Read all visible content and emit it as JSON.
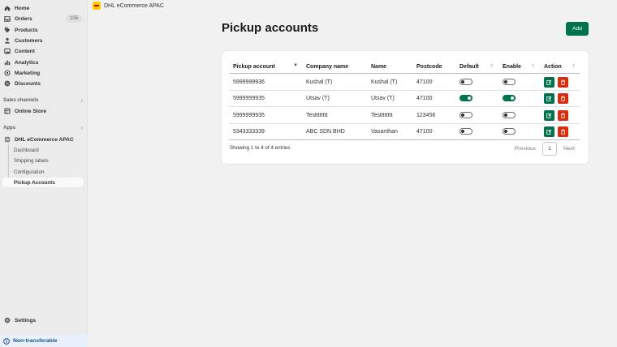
{
  "app": {
    "title": "DHL eCommerce APAC"
  },
  "sidebar": {
    "main": [
      {
        "label": "Home",
        "icon": "home-icon"
      },
      {
        "label": "Orders",
        "icon": "inbox-icon",
        "badge": "105"
      },
      {
        "label": "Products",
        "icon": "tag-icon"
      },
      {
        "label": "Customers",
        "icon": "person-icon"
      },
      {
        "label": "Content",
        "icon": "image-icon"
      },
      {
        "label": "Analytics",
        "icon": "bar-chart-icon"
      },
      {
        "label": "Marketing",
        "icon": "target-icon"
      },
      {
        "label": "Discounts",
        "icon": "discount-icon"
      }
    ],
    "sales_channels": {
      "label": "Sales channels",
      "items": [
        {
          "label": "Online Store",
          "icon": "store-icon"
        }
      ]
    },
    "apps": {
      "label": "Apps",
      "app_name": "DHL eCommerce APAC",
      "sub_items": [
        "Dashboard",
        "Shipping labels",
        "Configuration",
        "Pickup Accounts"
      ],
      "active": "Pickup Accounts"
    },
    "settings": {
      "label": "Settings",
      "icon": "gear-icon"
    },
    "footer": {
      "label": "Non-transferable",
      "icon": "info-icon"
    }
  },
  "page": {
    "title": "Pickup accounts",
    "add_label": "Add"
  },
  "table": {
    "headers": [
      "Pickup account",
      "Company name",
      "Name",
      "Postcode",
      "Default",
      "Enable",
      "Action"
    ],
    "rows": [
      {
        "account": "5999999936",
        "company": "Kushal (T)",
        "name": "Kushal (T)",
        "postcode": "47100",
        "default": false,
        "enable": false
      },
      {
        "account": "5999999935",
        "company": "Utsav (T)",
        "name": "Utsav (T)",
        "postcode": "47100",
        "default": true,
        "enable": true
      },
      {
        "account": "5999999935",
        "company": "Testttttttt",
        "name": "Testttttttt",
        "postcode": "123456",
        "default": false,
        "enable": false
      },
      {
        "account": "5343333339",
        "company": "ABC SDN BHD",
        "name": "Vasanthan",
        "postcode": "47100",
        "default": false,
        "enable": false
      }
    ]
  },
  "pagination": {
    "info": "Showing 1 to 4 of 4 entries",
    "previous": "Previous",
    "current": "1",
    "next": "Next"
  },
  "colors": {
    "primary": "#00734d",
    "danger": "#d72c0d",
    "brand_yellow": "#ffcc00",
    "brand_red": "#d40511"
  }
}
